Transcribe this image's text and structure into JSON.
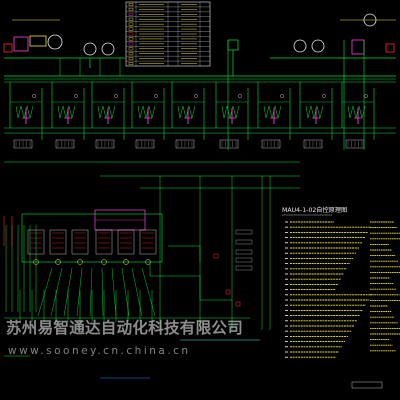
{
  "diagram": {
    "panel_title": "MAU4-1-02自控原理图",
    "watermark": {
      "company": "苏州易智通达自动化科技有限公司",
      "url": "www.sooney.cn.china.cn"
    },
    "colors": {
      "background": "#000000",
      "main_green": "#00e33a",
      "pink": "#ff3fe0",
      "white": "#e8e8e8",
      "yellow": "#f5e629",
      "red": "#ff2a2a",
      "blue": "#3a7bff",
      "cyan": "#3fe6e6",
      "watermark": "#ffffff"
    },
    "icons": [
      "sensor-symbol",
      "fan-symbol",
      "damper-symbol",
      "valve-symbol",
      "humidifier-symbol"
    ]
  }
}
